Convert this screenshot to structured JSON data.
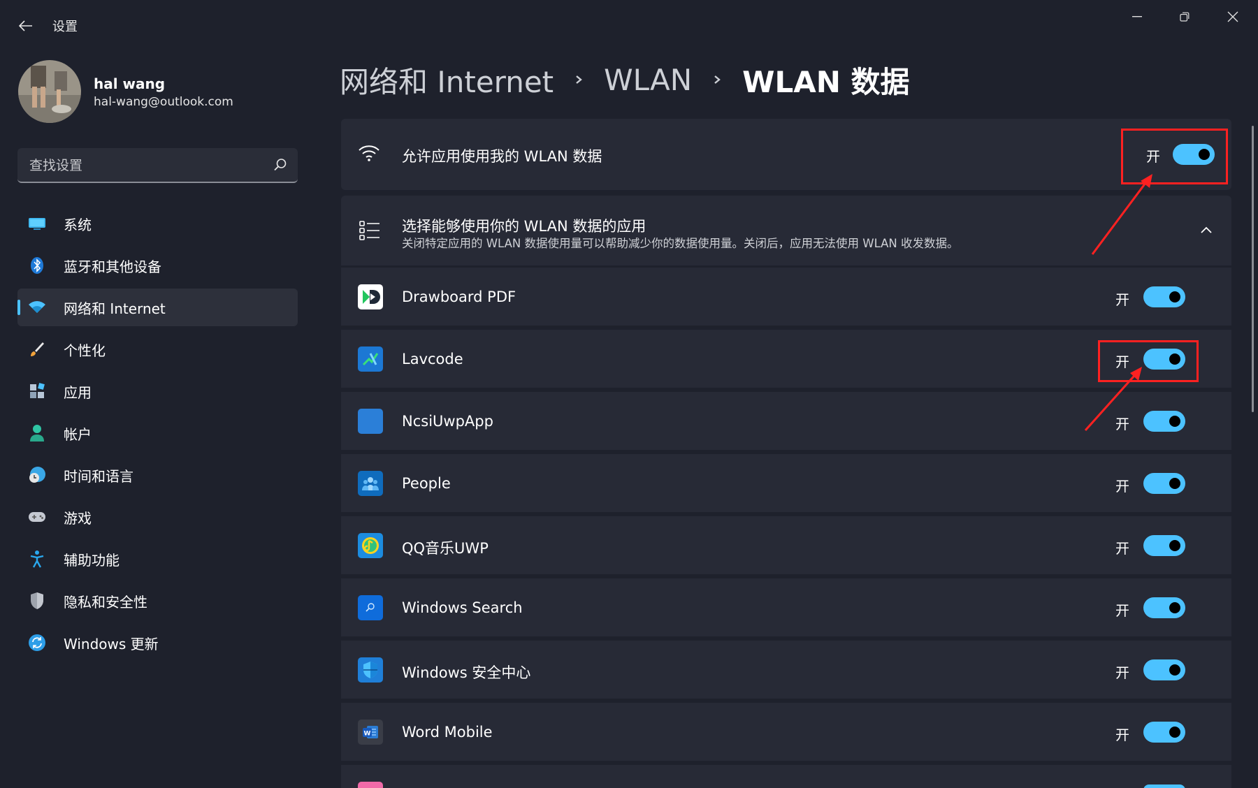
{
  "window": {
    "app_title": "设置",
    "controls": [
      "minimize",
      "restore",
      "close"
    ]
  },
  "user": {
    "name": "hal wang",
    "email": "hal-wang@outlook.com"
  },
  "search": {
    "placeholder": "查找设置"
  },
  "sidebar": {
    "items": [
      {
        "label": "系统",
        "icon": "system-icon",
        "active": false
      },
      {
        "label": "蓝牙和其他设备",
        "icon": "bluetooth-icon",
        "active": false
      },
      {
        "label": "网络和 Internet",
        "icon": "wifi-icon",
        "active": true
      },
      {
        "label": "个性化",
        "icon": "brush-icon",
        "active": false
      },
      {
        "label": "应用",
        "icon": "apps-icon",
        "active": false
      },
      {
        "label": "帐户",
        "icon": "account-icon",
        "active": false
      },
      {
        "label": "时间和语言",
        "icon": "time-language-icon",
        "active": false
      },
      {
        "label": "游戏",
        "icon": "gamepad-icon",
        "active": false
      },
      {
        "label": "辅助功能",
        "icon": "accessibility-icon",
        "active": false
      },
      {
        "label": "隐私和安全性",
        "icon": "shield-icon",
        "active": false
      },
      {
        "label": "Windows 更新",
        "icon": "update-icon",
        "active": false
      }
    ]
  },
  "breadcrumb": {
    "items": [
      "网络和 Internet",
      "WLAN"
    ],
    "current": "WLAN 数据"
  },
  "master_setting": {
    "label": "允许应用使用我的 WLAN 数据",
    "state_label": "开",
    "enabled": true
  },
  "apps_section": {
    "title": "选择能够使用你的 WLAN 数据的应用",
    "description": "关闭特定应用的 WLAN 数据使用量可以帮助减少你的数据使用量。关闭后，应用无法使用 WLAN 收发数据。",
    "expanded": true
  },
  "apps": [
    {
      "name": "Drawboard PDF",
      "state_label": "开",
      "enabled": true
    },
    {
      "name": "Lavcode",
      "state_label": "开",
      "enabled": true
    },
    {
      "name": "NcsiUwpApp",
      "state_label": "开",
      "enabled": true
    },
    {
      "name": "People",
      "state_label": "开",
      "enabled": true
    },
    {
      "name": "QQ音乐UWP",
      "state_label": "开",
      "enabled": true
    },
    {
      "name": "Windows Search",
      "state_label": "开",
      "enabled": true
    },
    {
      "name": "Windows 安全中心",
      "state_label": "开",
      "enabled": true
    },
    {
      "name": "Word Mobile",
      "state_label": "开",
      "enabled": true
    }
  ],
  "colors": {
    "accent": "#4cc2ff",
    "background": "#1e212c",
    "card": "#272a36",
    "annotation": "#ff2121"
  }
}
